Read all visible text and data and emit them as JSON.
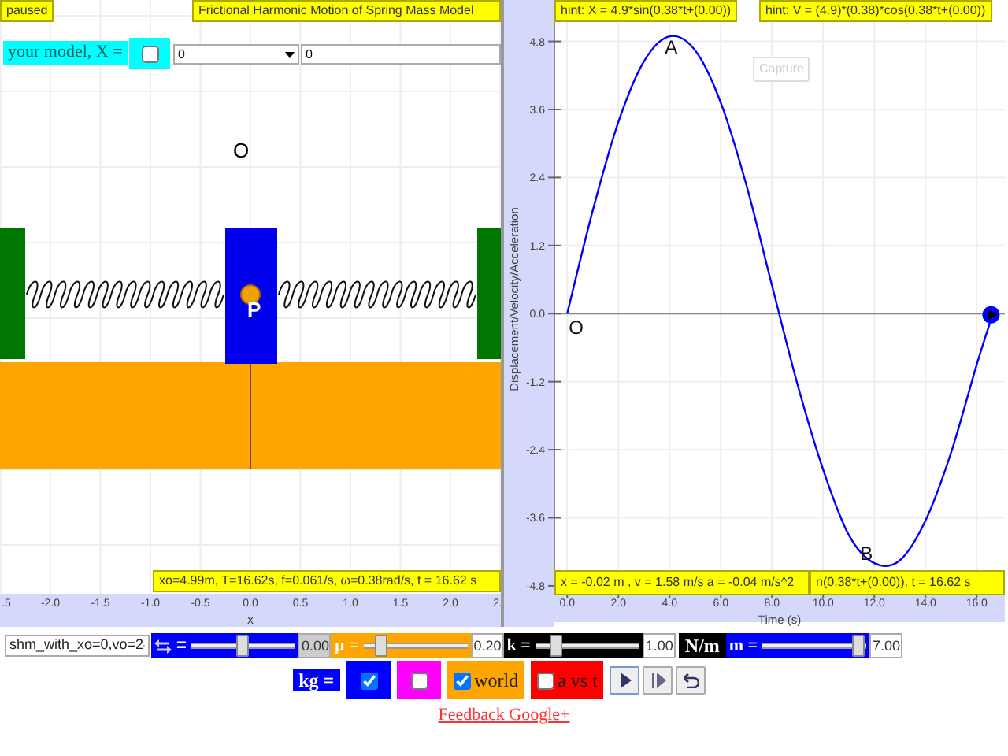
{
  "status": "paused",
  "title": "Frictional Harmonic Motion of Spring Mass Model",
  "model_row": {
    "label": "your model, X =",
    "checked": false,
    "select_value": "0",
    "input_value": "0"
  },
  "simulation": {
    "origin_label": "O",
    "mass_label": "P",
    "readout": "xo=4.99m, T=16.62s, f=0.061/s, ω=0.38rad/s, t = 16.62 s",
    "x_ticks": [
      ".5",
      "-2.0",
      "-1.5",
      "-1.0",
      "-0.5",
      "0.0",
      "0.5",
      "1.0",
      "1.5",
      "2.0",
      "2."
    ],
    "x_label": "x"
  },
  "graph": {
    "hints": [
      "hint: X = 4.9*sin(0.38*t+(0.00))",
      "hint: V = (4.9)*(0.38)*cos(0.38*t+(0.00))"
    ],
    "capture_button": "Capture",
    "readouts": [
      "x = -0.02 m , v = 1.58 m/s a = -0.04 m/s^2",
      "n(0.38*t+(0.00)), t = 16.62 s"
    ],
    "chart_data": {
      "type": "line",
      "xlabel": "Time (s)",
      "ylabel": "Displacement/Velocity/Acceleration",
      "x": [
        0,
        1,
        2,
        3,
        4,
        5,
        6,
        7,
        8,
        9,
        10,
        11,
        12,
        13,
        14,
        15,
        16,
        16.62
      ],
      "series": [
        {
          "color": "#0000ff",
          "values": [
            0,
            1.82,
            3.38,
            4.45,
            4.89,
            4.64,
            3.72,
            2.27,
            0.5,
            -1.25,
            -2.75,
            -3.9,
            -4.4,
            -4.35,
            -3.65,
            -2.45,
            -0.9,
            -0.02
          ]
        }
      ],
      "xlim": [
        -0.5,
        17.1
      ],
      "ylim": [
        -4.94,
        5.53
      ],
      "grid": true,
      "xticks": [
        {
          "value": 0,
          "label": "0.0"
        },
        {
          "value": 2,
          "label": "2.0"
        },
        {
          "value": 4,
          "label": "4.0"
        },
        {
          "value": 6,
          "label": "6.0"
        },
        {
          "value": 8,
          "label": "8.0"
        },
        {
          "value": 10,
          "label": "10.0"
        },
        {
          "value": 12,
          "label": "12.0"
        },
        {
          "value": 14,
          "label": "14.0"
        },
        {
          "value": 16,
          "label": "16.0"
        }
      ],
      "yticks": [
        -4.8,
        -3.6,
        -2.4,
        -1.2,
        {
          "value": 0,
          "label": "0.0"
        },
        1.2,
        2.4,
        3.6,
        4.8
      ],
      "annotations": [
        "A",
        "B",
        "O"
      ]
    }
  },
  "controls": {
    "preset": "shm_with_xo=0,vo=2",
    "sliders": [
      {
        "kind": "icon",
        "label": "=",
        "color": "#0000ff",
        "level": 0.5,
        "value": "0.00",
        "disabled": true
      },
      {
        "kind": "text",
        "label": "μ =",
        "color": "#ffa500",
        "level": 0.12,
        "value": "0.20",
        "disabled": false
      },
      {
        "kind": "text",
        "label": "k =",
        "color": "#000000",
        "level": 0.15,
        "value": "1.00",
        "disabled": false,
        "unit": "N/m"
      },
      {
        "kind": "text",
        "label": "m =",
        "color": "#0000ff",
        "level": 0.98,
        "value": "7.00",
        "disabled": false
      }
    ],
    "mass_unit": "kg =",
    "toggles": [
      {
        "color": "#0000ff",
        "checked": true
      },
      {
        "color": "#ff00ff",
        "checked": false
      },
      {
        "color": "#ffa500",
        "checked": true,
        "label": "world"
      },
      {
        "color": "#ff0000",
        "checked": false,
        "label": "a vs t"
      }
    ],
    "buttons": [
      {
        "kind": "play"
      },
      {
        "kind": "step"
      },
      {
        "kind": "reset"
      }
    ],
    "link": "Feedback Google+"
  }
}
